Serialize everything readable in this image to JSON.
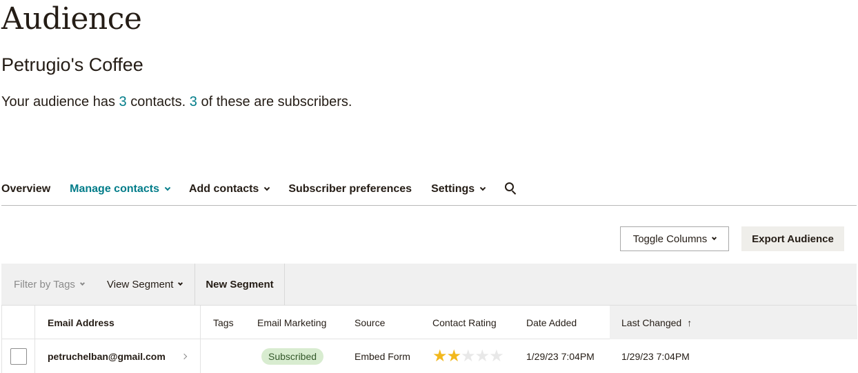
{
  "page": {
    "title": "Audience",
    "audience_name": "Petrugio's Coffee",
    "summary": {
      "prefix": "Your audience has ",
      "contacts_count": "3",
      "middle": " contacts. ",
      "subscribers_count": "3",
      "suffix": " of these are subscribers."
    }
  },
  "nav": {
    "items": [
      {
        "label": "Overview"
      },
      {
        "label": "Manage contacts"
      },
      {
        "label": "Add contacts"
      },
      {
        "label": "Subscriber preferences"
      },
      {
        "label": "Settings"
      }
    ]
  },
  "toolbar": {
    "toggle_columns_label": "Toggle Columns",
    "export_label": "Export Audience"
  },
  "filters": {
    "filter_by_tags": "Filter by Tags",
    "view_segment": "View Segment",
    "new_segment": "New Segment"
  },
  "table": {
    "columns": [
      "Email Address",
      "Tags",
      "Email Marketing",
      "Source",
      "Contact Rating",
      "Date Added",
      "Last Changed"
    ],
    "sort_indicator": "↑",
    "rows": [
      {
        "email": "petruchelban@gmail.com",
        "tags": "",
        "email_marketing": "Subscribed",
        "source": "Embed Form",
        "contact_rating": 2,
        "rating_max": 5,
        "date_added": "1/29/23 7:04PM",
        "last_changed": "1/29/23 7:04PM"
      }
    ]
  },
  "colors": {
    "accent": "#007c89",
    "text": "#241c15",
    "star_on": "#f2b81d",
    "badge_bg": "#d8ecd0"
  }
}
